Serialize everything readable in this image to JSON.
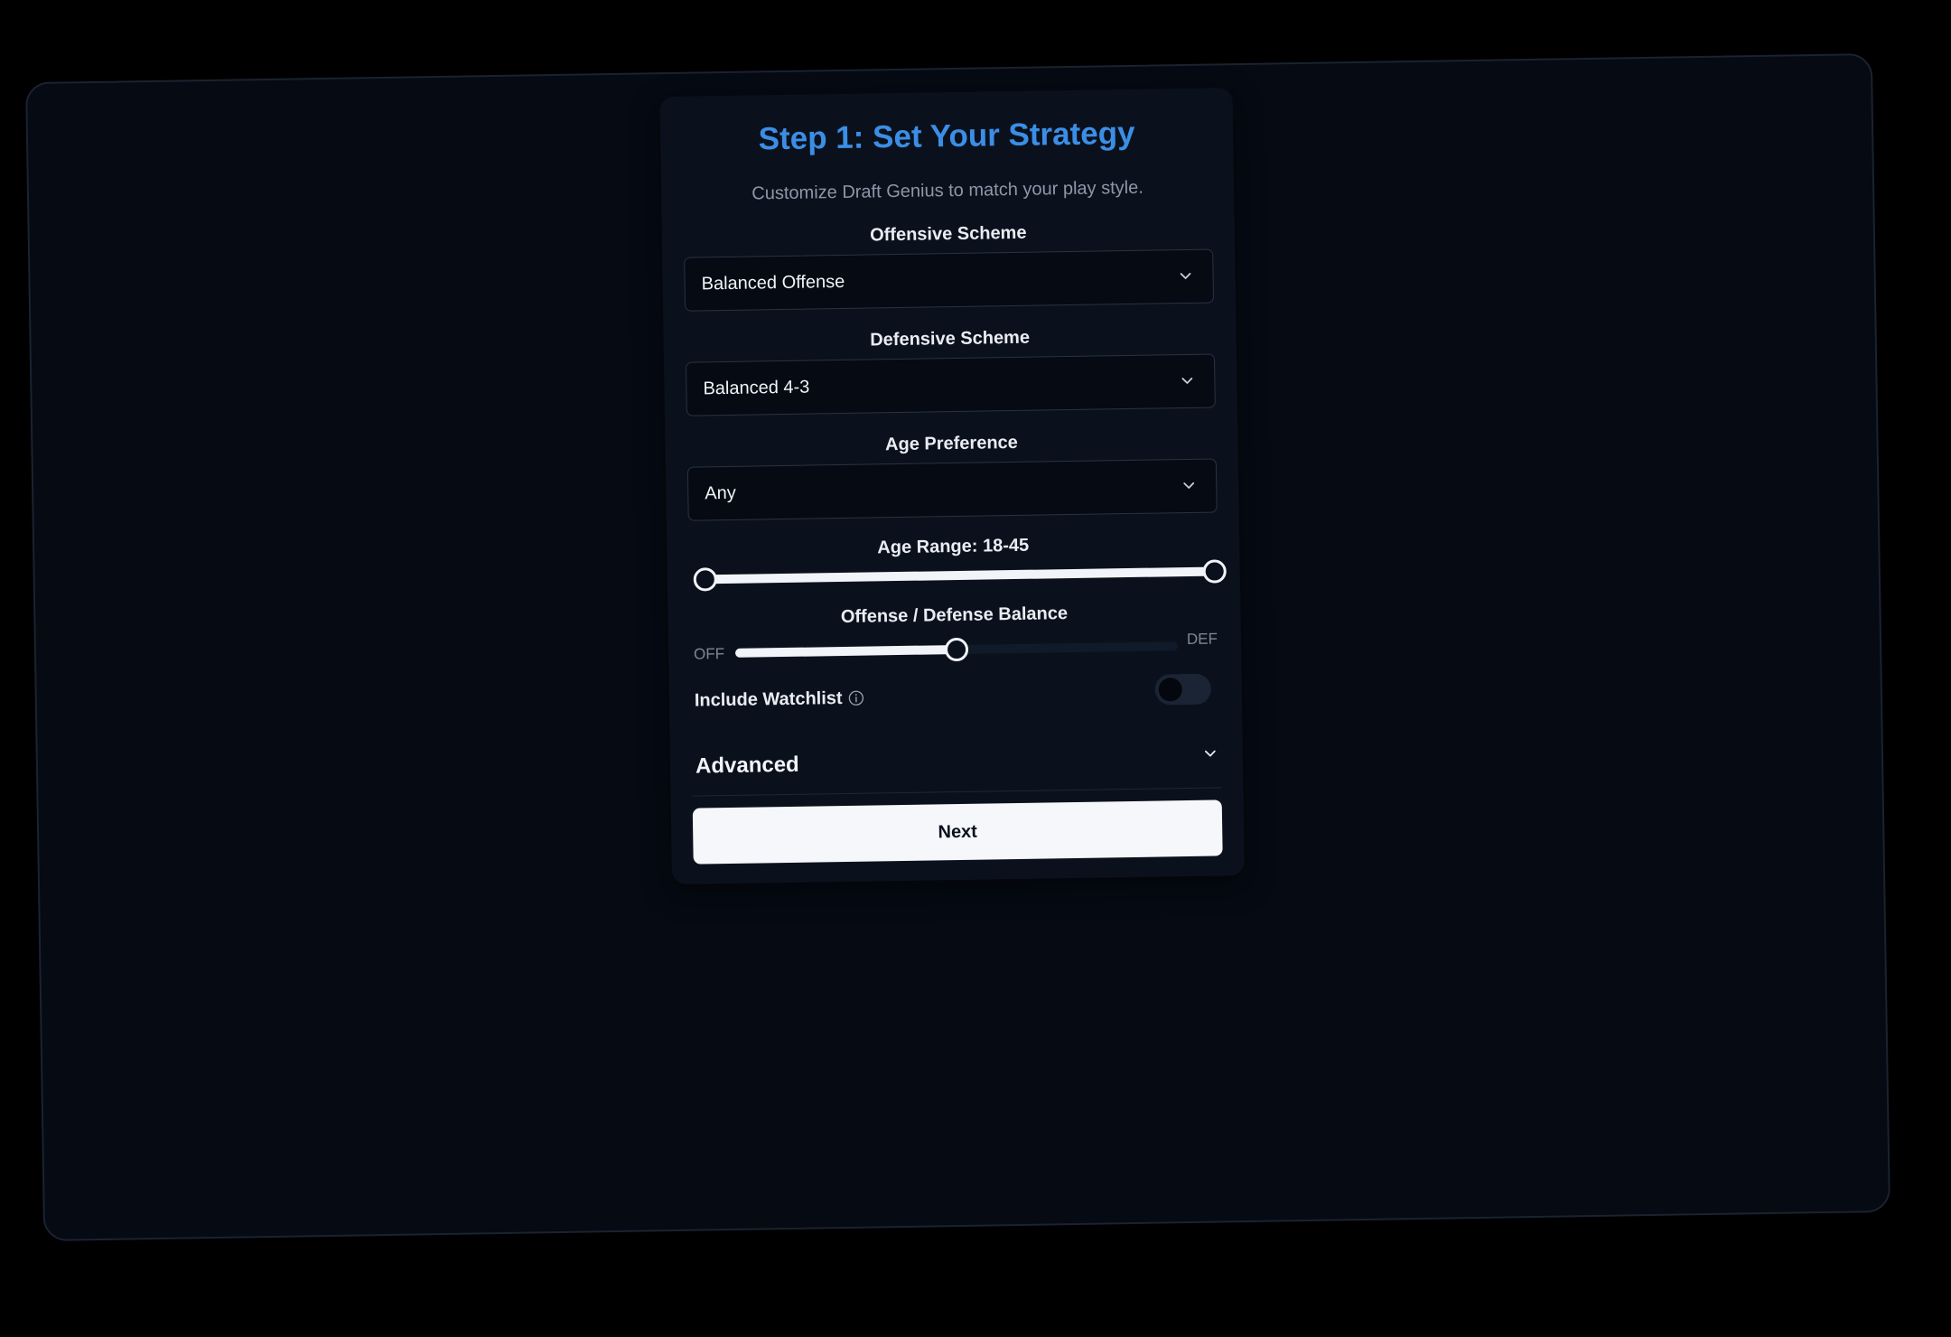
{
  "card": {
    "title": "Step 1: Set Your Strategy",
    "subtitle": "Customize Draft Genius to match your play style."
  },
  "offensive": {
    "label": "Offensive Scheme",
    "value": "Balanced Offense"
  },
  "defensive": {
    "label": "Defensive Scheme",
    "value": "Balanced 4-3"
  },
  "age_pref": {
    "label": "Age Preference",
    "value": "Any"
  },
  "age_range": {
    "label": "Age Range: 18-45",
    "min": 18,
    "max": 45,
    "low": 18,
    "high": 45
  },
  "balance": {
    "label": "Offense / Defense Balance",
    "left_label": "OFF",
    "right_label": "DEF",
    "value_fraction": 0.5
  },
  "watchlist": {
    "label": "Include Watchlist",
    "enabled": false
  },
  "advanced": {
    "label": "Advanced"
  },
  "next_button": {
    "label": "Next"
  },
  "colors": {
    "accent": "#3b8ee6",
    "page_background": "#050a13",
    "card_background": "#0b111c",
    "button_background": "#f5f7fa"
  },
  "icons": {
    "select_chevron": "chevron-down-icon",
    "info": "info-icon",
    "advanced_chevron": "chevron-down-icon"
  }
}
